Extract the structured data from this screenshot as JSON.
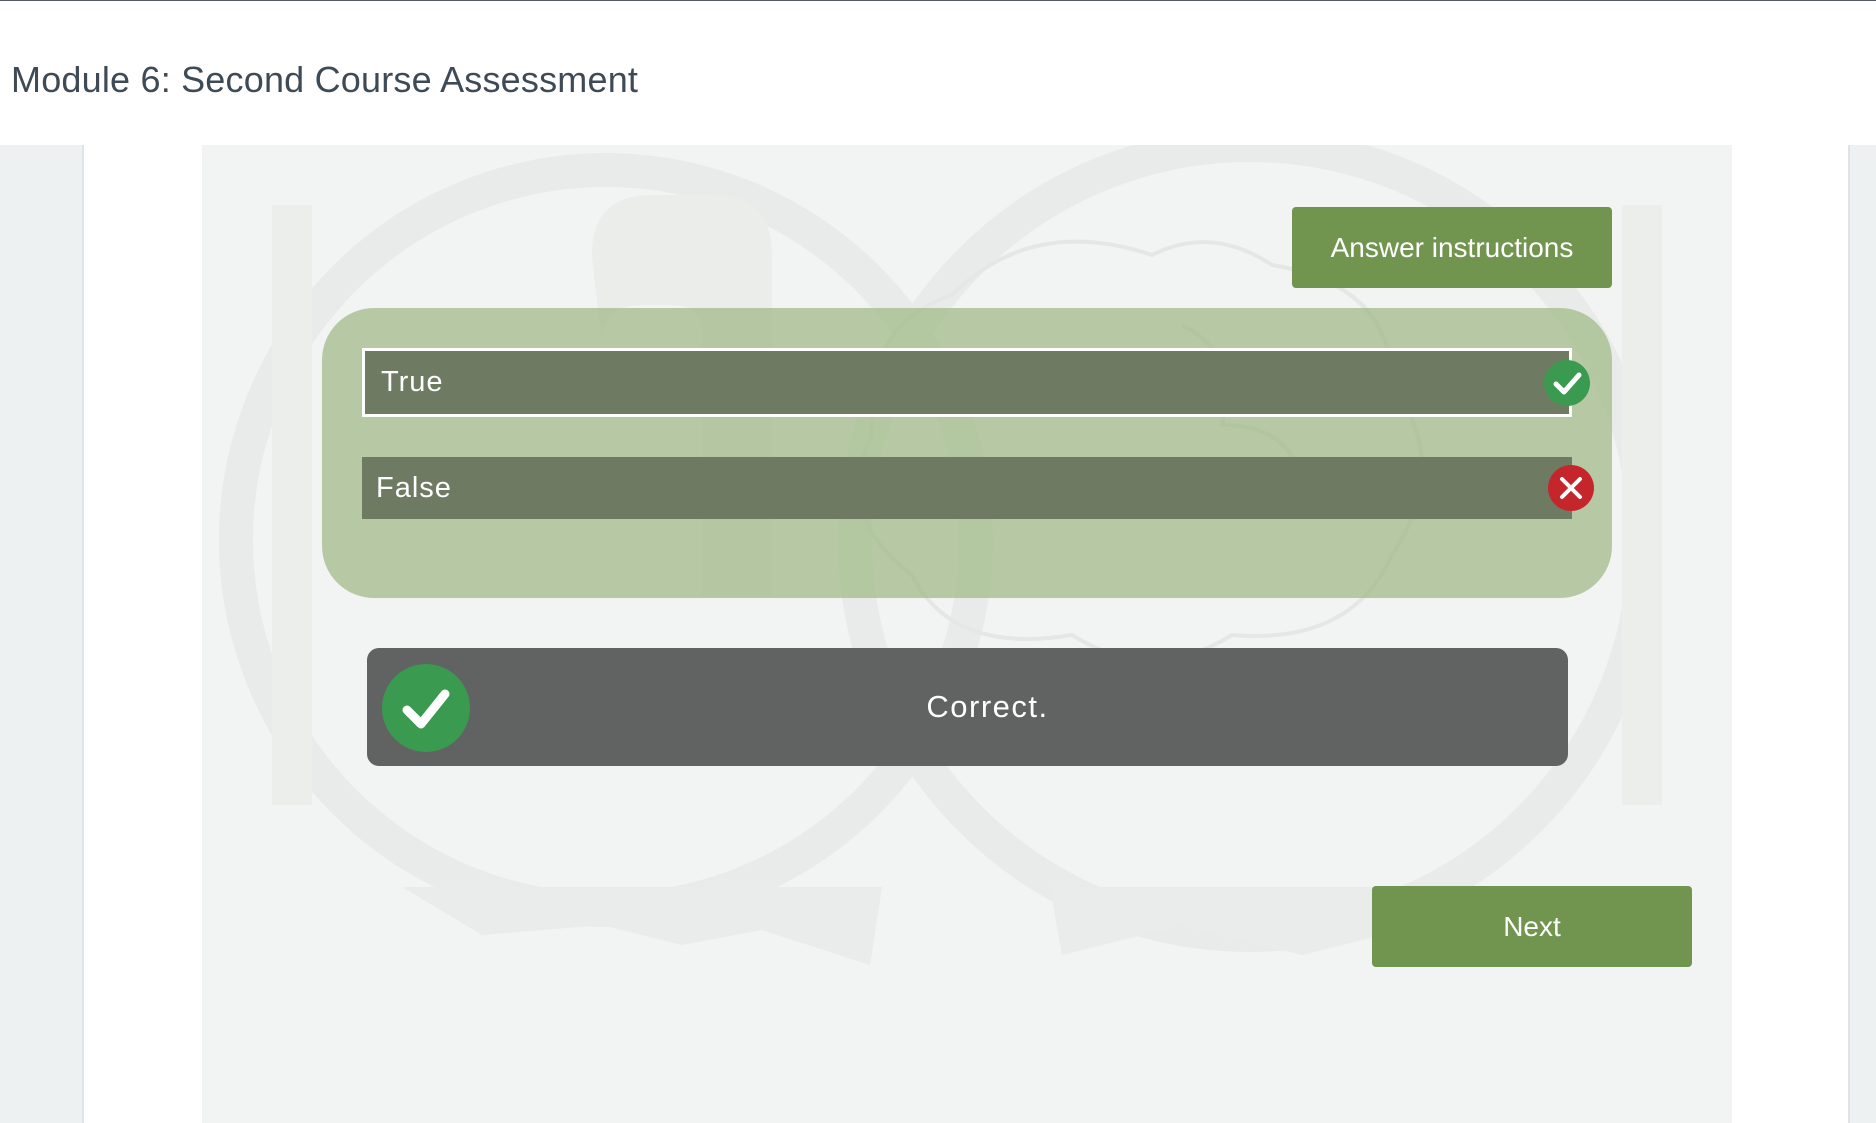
{
  "header": {
    "title": "Module 6: Second Course Assessment"
  },
  "quiz": {
    "instructions_button": "Answer instructions",
    "options": [
      {
        "label": "True",
        "status": "correct",
        "selected": true
      },
      {
        "label": "False",
        "status": "incorrect",
        "selected": false
      }
    ],
    "feedback": {
      "text": "Correct.",
      "icon": "check-circle-icon"
    },
    "next_button": "Next"
  },
  "colors": {
    "accent_green": "#71944f",
    "panel_green": "#b5c7a5",
    "option_bg": "#6e7b62",
    "feedback_bg": "#616262",
    "correct_green": "#3a9a4f",
    "incorrect_red": "#c4262b",
    "title_text": "#3e4a55"
  }
}
